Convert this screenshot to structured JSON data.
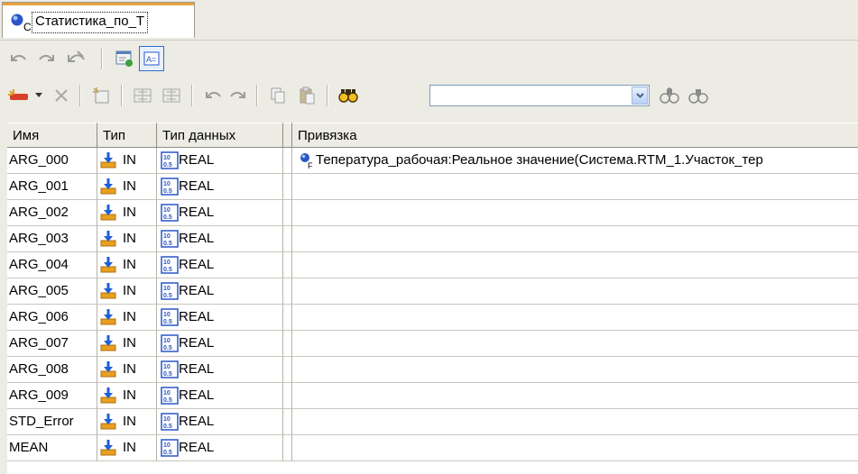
{
  "tab": {
    "label": "Статистика_по_Т",
    "icon": "c-object-icon"
  },
  "toolbar1": {
    "icons": [
      "undo-icon",
      "redo-icon",
      "undo-all-icon",
      "properties-icon",
      "arguments-view-icon"
    ]
  },
  "toolbar2": {
    "icons": [
      "new-argument-icon",
      "dropdown-arrow-icon",
      "delete-icon",
      "import-icon",
      "grid-view-icon",
      "grid-view-2-icon",
      "undo-icon",
      "redo-icon",
      "copy-icon",
      "paste-icon",
      "find-icon",
      "find-next-icon",
      "find-prev-icon"
    ],
    "search_value": ""
  },
  "grid": {
    "headers": {
      "name": "Имя",
      "type": "Тип",
      "dtype": "Тип данных",
      "bind": "Привязка"
    },
    "rows": [
      {
        "name": "ARG_000",
        "type": "IN",
        "dtype": "REAL",
        "bind": "Тепература_рабочая:Реальное значение(Система.RTM_1.Участок_тер"
      },
      {
        "name": "ARG_001",
        "type": "IN",
        "dtype": "REAL",
        "bind": ""
      },
      {
        "name": "ARG_002",
        "type": "IN",
        "dtype": "REAL",
        "bind": ""
      },
      {
        "name": "ARG_003",
        "type": "IN",
        "dtype": "REAL",
        "bind": ""
      },
      {
        "name": "ARG_004",
        "type": "IN",
        "dtype": "REAL",
        "bind": ""
      },
      {
        "name": "ARG_005",
        "type": "IN",
        "dtype": "REAL",
        "bind": ""
      },
      {
        "name": "ARG_006",
        "type": "IN",
        "dtype": "REAL",
        "bind": ""
      },
      {
        "name": "ARG_007",
        "type": "IN",
        "dtype": "REAL",
        "bind": ""
      },
      {
        "name": "ARG_008",
        "type": "IN",
        "dtype": "REAL",
        "bind": ""
      },
      {
        "name": "ARG_009",
        "type": "IN",
        "dtype": "REAL",
        "bind": ""
      },
      {
        "name": "STD_Error",
        "type": "IN",
        "dtype": "REAL",
        "bind": ""
      },
      {
        "name": "MEAN",
        "type": "IN",
        "dtype": "REAL",
        "bind": ""
      }
    ]
  },
  "colors": {
    "accent_tab": "#e8a23a",
    "icon_blue": "#2a56c6",
    "background": "#ecebe4"
  }
}
